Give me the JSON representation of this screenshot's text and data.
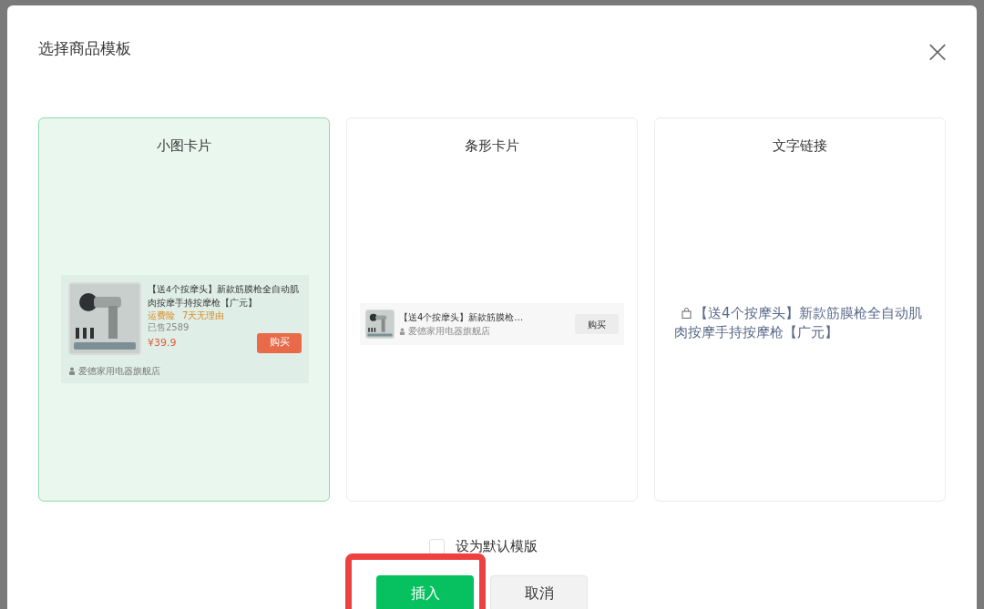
{
  "dialog": {
    "title": "选择商品模板",
    "close": "×"
  },
  "templates": [
    {
      "kind": "small_card",
      "label": "小图卡片",
      "selected": true,
      "product": {
        "title": "【送4个按摩头】新款筋膜枪全自动肌肉按摩手持按摩枪【广元】",
        "tags": [
          "运费险",
          "7天无理由"
        ],
        "sold": "已售2589",
        "price": "¥39.9",
        "buy": "购买",
        "store": "爱德家用电器旗舰店"
      }
    },
    {
      "kind": "strip_card",
      "label": "条形卡片",
      "selected": false,
      "product": {
        "title": "【送4个按摩头】新款筋膜枪…",
        "store": "爱德家用电器旗舰店",
        "buy": "购买"
      }
    },
    {
      "kind": "text_link",
      "label": "文字链接",
      "selected": false,
      "product": {
        "title": "【送4个按摩头】新款筋膜枪全自动肌肉按摩手持按摩枪【广元】"
      }
    }
  ],
  "default_option": {
    "label": "设为默认模版",
    "checked": false
  },
  "buttons": [
    {
      "kind": "primary",
      "label": "插入",
      "highlighted": true
    },
    {
      "kind": "secondary",
      "label": "取消",
      "highlighted": false
    }
  ]
}
